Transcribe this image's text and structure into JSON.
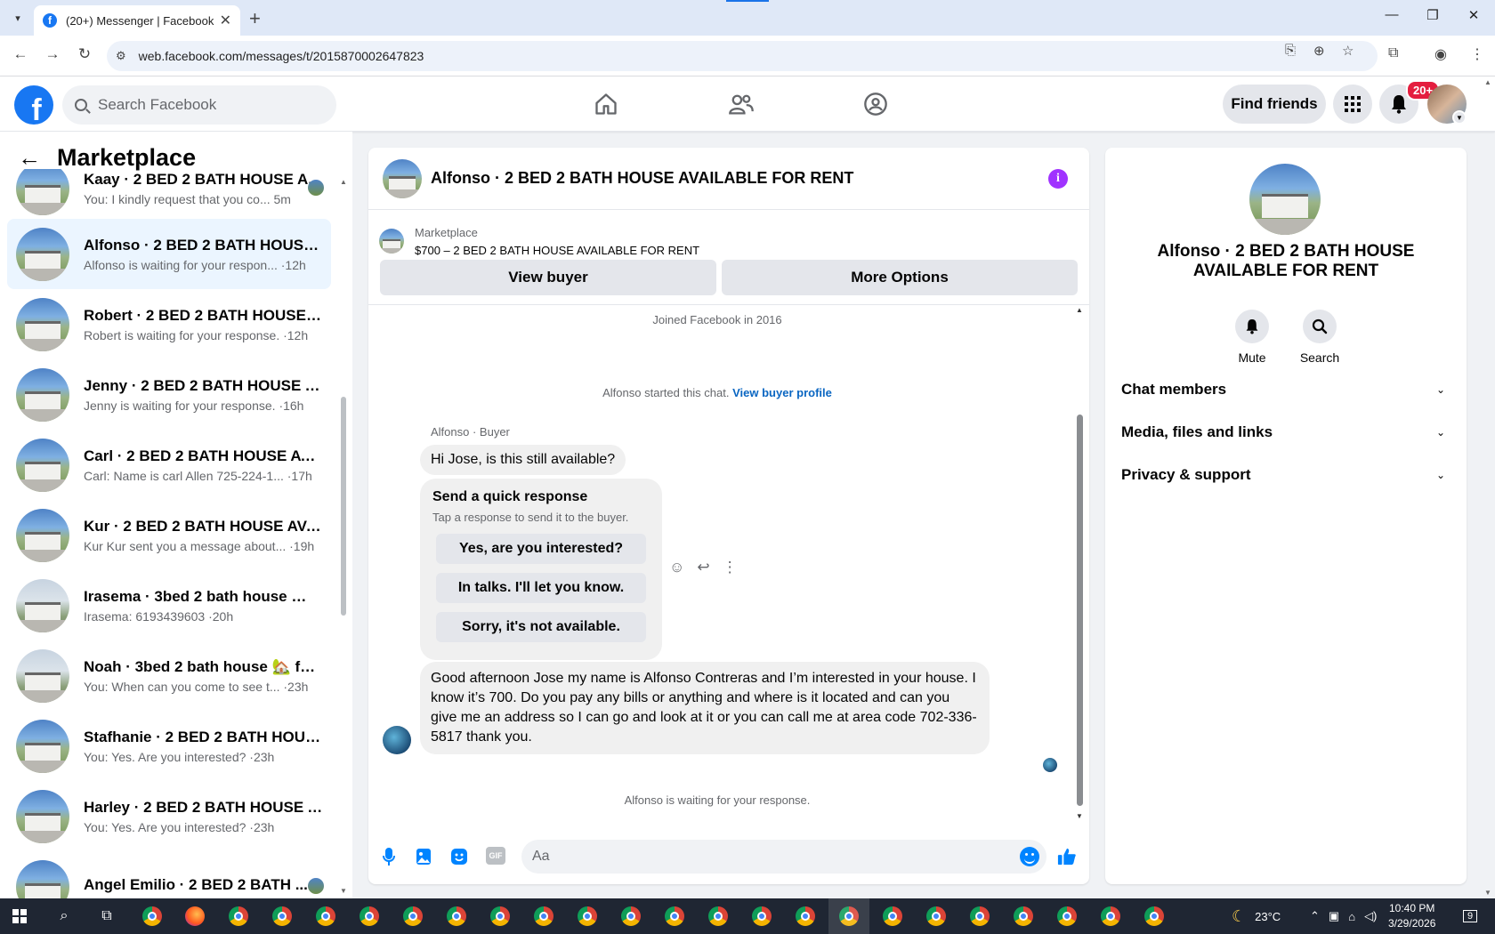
{
  "browser": {
    "tab_title": "(20+) Messenger | Facebook",
    "url": "web.facebook.com/messages/t/2015870002647823"
  },
  "fb": {
    "search_placeholder": "Search Facebook",
    "find_friends": "Find friends",
    "notif_count": "20+"
  },
  "sidebar": {
    "title": "Marketplace",
    "conversations": [
      {
        "name": "Kaay · 2 BED 2 BATH HOUSE A...",
        "preview": "You: I kindly request that you co... 5m",
        "active": false
      },
      {
        "name": "Alfonso · 2 BED 2 BATH HOUSE ...",
        "preview": "Alfonso is waiting for your respon... ·12h",
        "active": true
      },
      {
        "name": "Robert · 2 BED 2 BATH HOUSE A...",
        "preview": "Robert is waiting for your response. ·12h",
        "active": false
      },
      {
        "name": "Jenny · 2 BED 2 BATH HOUSE AV...",
        "preview": "Jenny is waiting for your response. ·16h",
        "active": false
      },
      {
        "name": "Carl · 2 BED 2 BATH HOUSE AVAI...",
        "preview": "Carl: Name is carl Allen 725-224-1... ·17h",
        "active": false
      },
      {
        "name": "Kur · 2 BED 2 BATH HOUSE AVAI...",
        "preview": "Kur Kur sent you a message about... ·19h",
        "active": false
      },
      {
        "name": "Irasema · 3bed 2 bath house 🏡 ...",
        "preview": "Irasema: 6193439603 ·20h",
        "active": false
      },
      {
        "name": "Noah · 3bed 2 bath house 🏡 for...",
        "preview": "You: When can you come to see t... ·23h",
        "active": false
      },
      {
        "name": "Stafhanie · 2 BED 2 BATH HOUS...",
        "preview": "You: Yes. Are you interested? ·23h",
        "active": false
      },
      {
        "name": "Harley · 2 BED 2 BATH HOUSE A...",
        "preview": "You: Yes. Are you interested? ·23h",
        "active": false
      },
      {
        "name": "Angel Emilio · 2 BED 2 BATH ...",
        "preview": "",
        "active": false
      }
    ]
  },
  "chat": {
    "title": "Alfonso · 2 BED 2 BATH HOUSE AVAILABLE FOR RENT",
    "listing_category": "Marketplace",
    "listing_price_title": "$700 – 2 BED 2 BATH HOUSE AVAILABLE FOR RENT",
    "view_buyer": "View buyer",
    "more_options": "More Options",
    "joined": "Joined Facebook in 2016",
    "started_text": "Alfonso started this chat.",
    "view_buyer_profile": "View buyer profile",
    "sender_label": "Alfonso · Buyer",
    "msg1": "Hi Jose, is this still available?",
    "quick_title": "Send a quick response",
    "quick_sub": "Tap a response to send it to the buyer.",
    "quick_replies": [
      "Yes, are you interested?",
      "In talks. I'll let you know.",
      "Sorry, it's not available."
    ],
    "msg2": "Good afternoon Jose my name is Alfonso Contreras and I’m interested in your house. I know it’s 700. Do you pay any bills or anything and where is it located and can you give me an address so I can go and look at it or you can call me at area code 702-336-5817 thank you.",
    "waiting": "Alfonso is waiting for your response.",
    "input_placeholder": "Aa",
    "gif": "GIF"
  },
  "info": {
    "title": "Alfonso · 2 BED 2 BATH HOUSE AVAILABLE FOR RENT",
    "mute": "Mute",
    "search": "Search",
    "sections": [
      "Chat members",
      "Media, files and links",
      "Privacy & support"
    ]
  },
  "taskbar": {
    "weather": "23°C",
    "time": "10:40 PM",
    "date": "3/29/2026",
    "notif": "9"
  }
}
